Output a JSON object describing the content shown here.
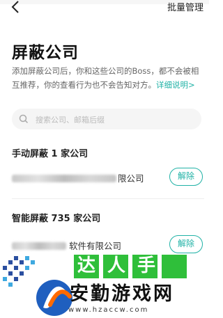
{
  "nav": {
    "batch_label": "批量管理"
  },
  "page": {
    "title": "屏蔽公司",
    "description": "添加屏蔽公司后，你和这些公司的Boss，都不会被相互推荐，你的查看行为也不会告知对方。",
    "detail_link": "详细说明>"
  },
  "search": {
    "placeholder": "搜索公司、邮箱后缀"
  },
  "manual": {
    "title": "手动屏蔽 1 家公司",
    "items": [
      {
        "visible_name": "限公司",
        "action": "解除"
      }
    ]
  },
  "smart": {
    "title": "智能屏蔽 735 家公司",
    "items": [
      {
        "visible_name": "软件有限公司",
        "action": "解除"
      }
    ]
  },
  "watermark": {
    "top_text": "达人手游",
    "brand": "安勤游戏网",
    "url": "www.hzaccw.com"
  },
  "colors": {
    "accent": "#20b2a6",
    "text": "#222222",
    "muted": "#666666"
  }
}
